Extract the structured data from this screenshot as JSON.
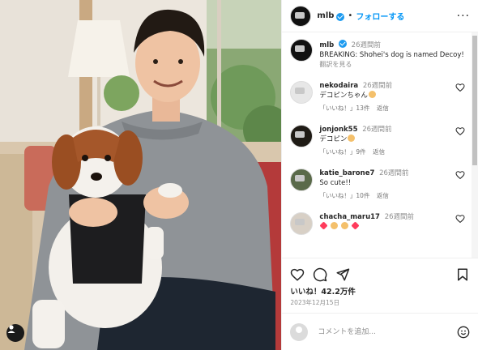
{
  "header": {
    "username": "mlb",
    "follow_label": "フォローする",
    "dot": "•",
    "more": "···"
  },
  "caption": {
    "username": "mlb",
    "time_ago": "26週間前",
    "text": "BREAKING: Shohei's dog is named Decoy!",
    "translate_label": "翻訳を見る"
  },
  "comments": [
    {
      "username": "nekodaira",
      "time_ago": "26週間前",
      "text": "デコピンちゃん",
      "likes": "「いいね！」13件",
      "reply": "返信",
      "avatar_color": "#e7e7e7"
    },
    {
      "username": "jonjonk55",
      "time_ago": "26週間前",
      "text": "デコピン",
      "likes": "「いいね！」9件",
      "reply": "返信",
      "avatar_color": "#1f1b15"
    },
    {
      "username": "katie_barone7",
      "time_ago": "26週間前",
      "text": "So cute!!",
      "likes": "「いいね！」10件",
      "reply": "返信",
      "avatar_color": "#5a6a4a"
    },
    {
      "username": "chacha_maru17",
      "time_ago": "26週間前",
      "text": "",
      "likes": "",
      "reply": "",
      "avatar_color": "#d8d0c6"
    }
  ],
  "actions": {
    "likes_text": "いいね！42.2万件",
    "date_text": "2023年12月15日"
  },
  "compose": {
    "placeholder": "コメントを追加..."
  },
  "colors": {
    "accent": "#0095f6",
    "verified": "#1d9bf0",
    "muted": "#8e8e8e"
  }
}
